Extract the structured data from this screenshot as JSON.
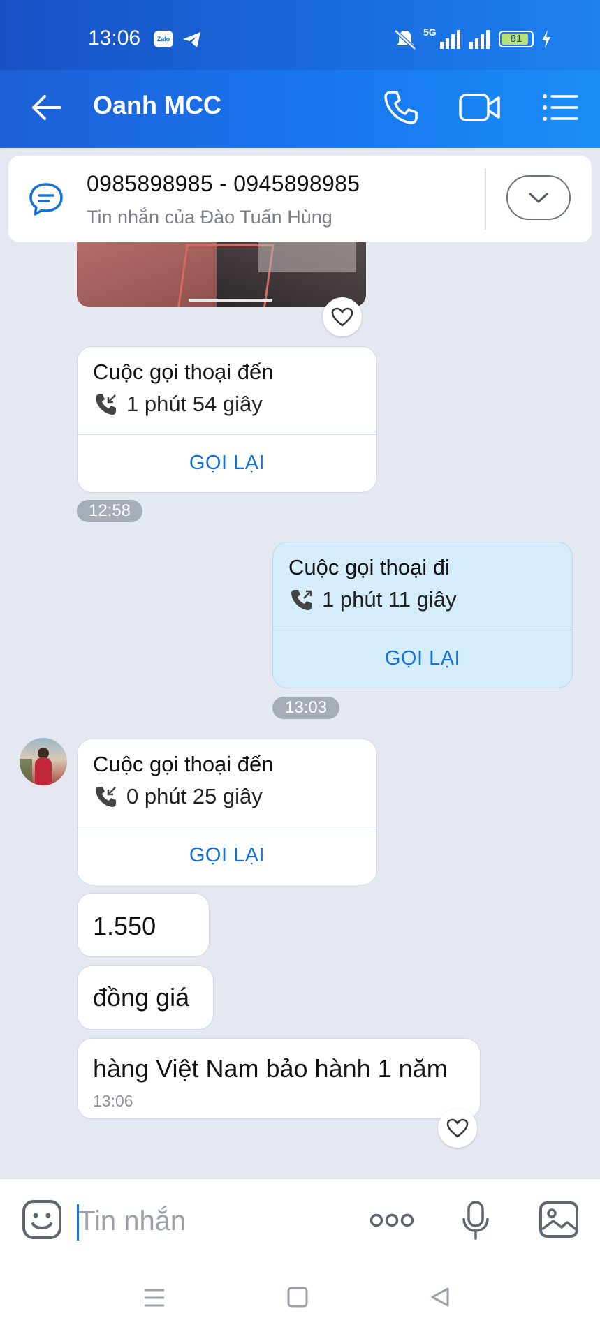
{
  "status_bar": {
    "time": "13:06",
    "network": "5G",
    "battery": "81"
  },
  "header": {
    "title": "Oanh MCC",
    "icons": [
      "back-arrow-icon",
      "phone-icon",
      "video-icon",
      "list-icon"
    ]
  },
  "pinned": {
    "line1": "0985898985 - 0945898985",
    "line2": "Tin nhắn của Đào Tuấn Hùng"
  },
  "messages": {
    "call1": {
      "title": "Cuộc gọi thoại đến",
      "duration": "1 phút 54 giây",
      "action": "GỌI LẠI"
    },
    "time1": "12:58",
    "call2": {
      "title": "Cuộc gọi thoại đi",
      "duration": "1 phút 11 giây",
      "action": "GỌI LẠI"
    },
    "time2": "13:03",
    "call3": {
      "title": "Cuộc gọi thoại đến",
      "duration": "0 phút 25 giây",
      "action": "GỌI LẠI"
    },
    "text1": "1.550",
    "text2": "đồng giá",
    "text3": "hàng Việt Nam bảo hành 1 năm",
    "text3_time": "13:06"
  },
  "composer": {
    "placeholder": "Tin nhắn"
  },
  "colors": {
    "header": "#1877f0",
    "accent": "#1673d6",
    "chat_bg": "#e4e8f1",
    "outgoing_bubble": "#d5ecfb"
  }
}
